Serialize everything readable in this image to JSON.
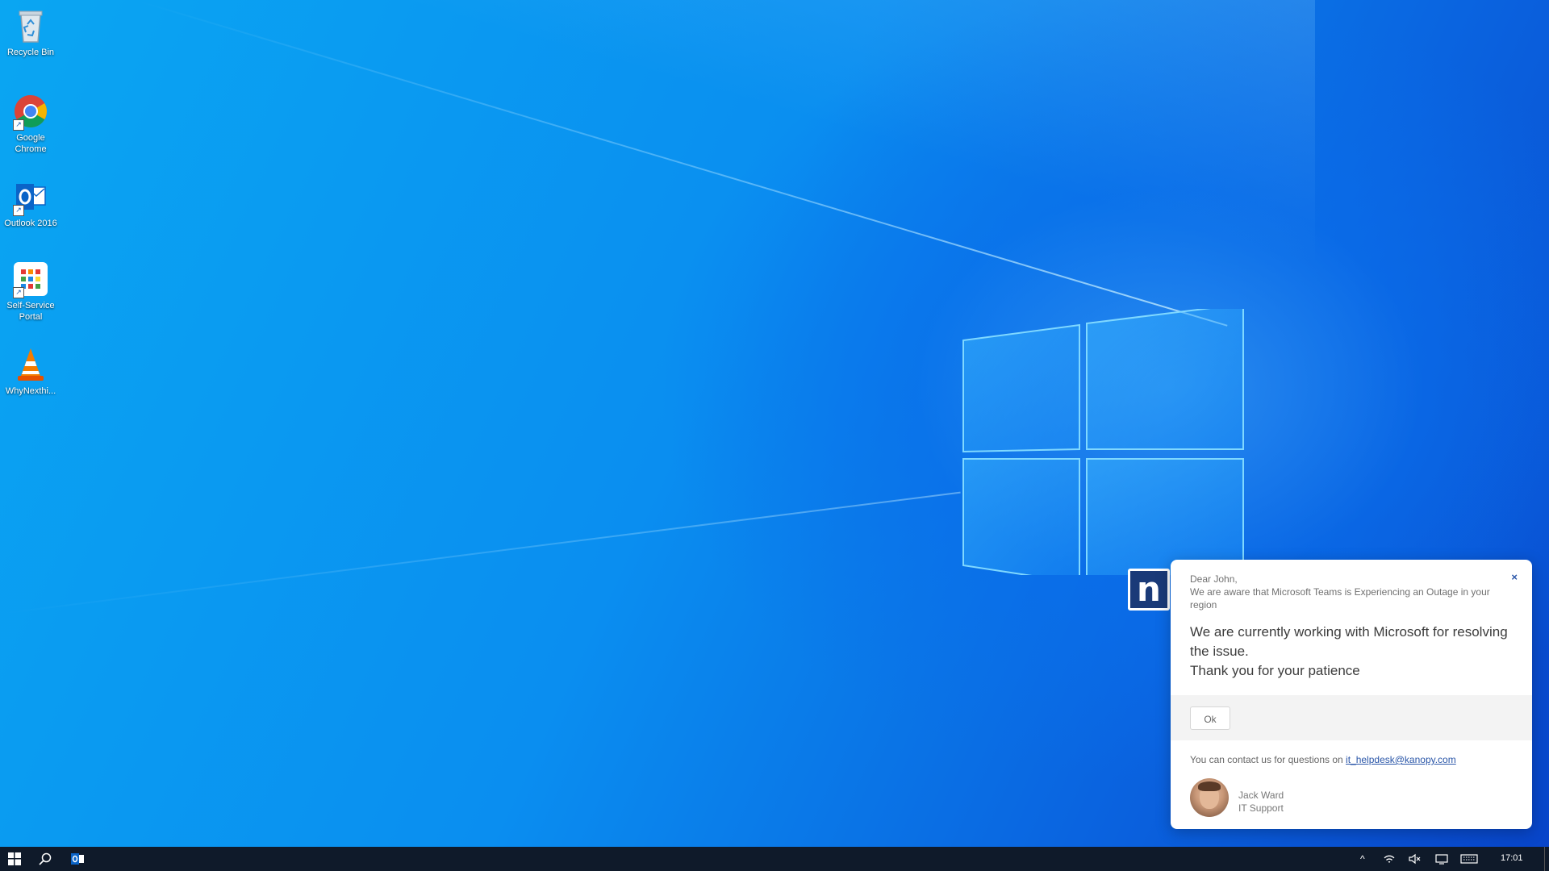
{
  "desktop": {
    "icons": [
      {
        "label": "Recycle Bin",
        "icon": "recycle-bin-icon"
      },
      {
        "label": "Google\nChrome",
        "icon": "chrome-icon"
      },
      {
        "label": "Outlook 2016",
        "icon": "outlook-icon"
      },
      {
        "label": "Self-Service\nPortal",
        "icon": "portal-grid-icon"
      },
      {
        "label": "WhyNexthi...",
        "icon": "vlc-cone-icon"
      }
    ]
  },
  "notification": {
    "logo_letter": "n",
    "greeting": "Dear John,",
    "intro": "We are aware that Microsoft Teams is Experiencing an Outage in your region",
    "message_line1": "We are currently working with Microsoft for resolving the issue.",
    "message_line2": "Thank you for your patience",
    "ok_label": "Ok",
    "close_label": "×",
    "contact_text": "You can contact us for questions on",
    "contact_email": "it_helpdesk@kanopy.com",
    "signer_name": "Jack Ward",
    "signer_title": "IT Support"
  },
  "taskbar": {
    "start_icon": "windows-start-icon",
    "search_icon": "search-icon",
    "pinned_app_icon": "outlook-icon",
    "tray": {
      "chevron": "^",
      "clock": "17:01"
    }
  },
  "colors": {
    "desktop_blue": "#0a8ef0",
    "taskbar": "#0f1a2a",
    "notif_accent": "#2a56a8",
    "logo_navy": "#1a3a78"
  }
}
